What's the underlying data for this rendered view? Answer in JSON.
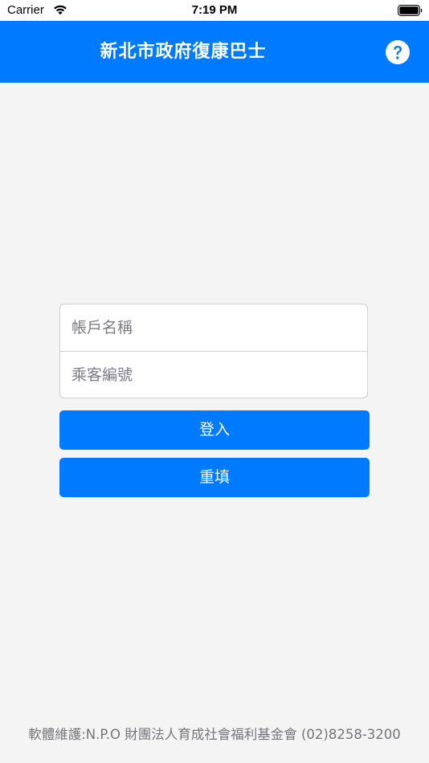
{
  "status_bar": {
    "carrier": "Carrier",
    "time": "7:19 PM"
  },
  "header": {
    "title": "新北市政府復康巴士",
    "help_icon": "question-circle-icon",
    "background_color": "#007aff"
  },
  "form": {
    "account_placeholder": "帳戶名稱",
    "passenger_placeholder": "乘客編號"
  },
  "buttons": {
    "login_label": "登入",
    "reset_label": "重填"
  },
  "footer": {
    "text": "軟體維護:N.P.O 財團法人育成社會福利基金會 (02)8258-3200"
  }
}
